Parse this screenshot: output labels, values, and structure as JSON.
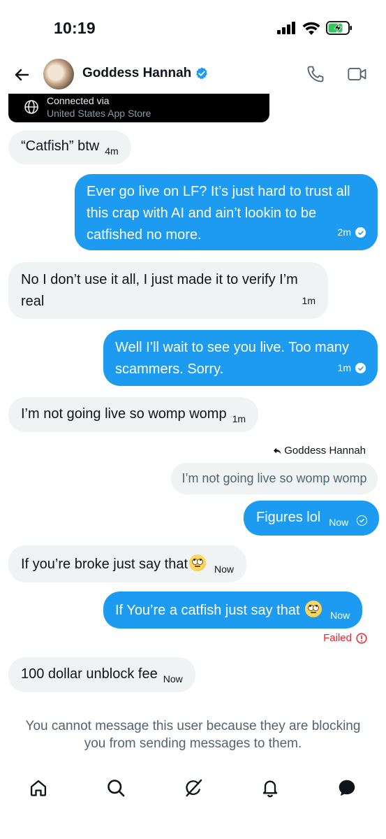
{
  "status_bar": {
    "time": "10:19"
  },
  "header": {
    "name": "Goddess Hannah"
  },
  "connected": {
    "line1": "Connected via",
    "line2": "United States App Store"
  },
  "messages": [
    {
      "dir": "in",
      "text": "“Catfish” btw",
      "time": "4m"
    },
    {
      "dir": "out",
      "text": "Ever go live on LF? It’s just hard to trust all this crap with AI and ain’t lookin to be catfished no more.",
      "time": "2m"
    },
    {
      "dir": "in",
      "text": "No I don’t use it all, I just made it to verify I’m real",
      "time": "1m"
    },
    {
      "dir": "out",
      "text": "Well I’ll wait to see you live. Too many scammers. Sorry.",
      "time": "1m"
    },
    {
      "dir": "in",
      "text": "I’m not going live so womp womp",
      "time": "1m"
    },
    {
      "dir": "out",
      "text": "Figures lol",
      "time": "Now"
    },
    {
      "dir": "in",
      "text": "If you’re broke just say that",
      "time": "Now"
    },
    {
      "dir": "out",
      "text": "If You’re a catfish just say that",
      "time": "Now"
    },
    {
      "dir": "in",
      "text": "100 dollar unblock fee",
      "time": "Now"
    }
  ],
  "reply": {
    "to": "Goddess Hannah",
    "quoted": "I’m not going live so womp womp"
  },
  "failed_label": "Failed",
  "blocked_note": "You cannot message this user because they are blocking you from sending messages to them.",
  "icons": {
    "verified": "verified-badge-icon",
    "emoji": "face-with-rolling-eyes-emoji"
  },
  "colors": {
    "accent": "#1d9bf0",
    "incoming": "#eff3f4",
    "failed": "#f4212e",
    "text": "#0f1419",
    "muted": "#536471"
  }
}
